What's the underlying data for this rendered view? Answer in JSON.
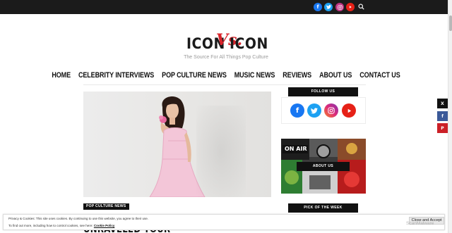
{
  "header": {
    "social_icons": [
      "facebook-icon",
      "twitter-icon",
      "instagram-icon",
      "youtube-icon"
    ],
    "search_icon": "search-icon"
  },
  "logo": {
    "left": "ICON",
    "vs": "Vs.",
    "right": "ICON",
    "tagline": "The Source For All Things Pop Culture"
  },
  "nav": {
    "items": [
      "HOME",
      "CELEBRITY INTERVIEWS",
      "POP CULTURE NEWS",
      "MUSIC NEWS",
      "REVIEWS",
      "ABOUT US",
      "CONTACT US"
    ]
  },
  "featured": {
    "category": "POP CULTURE NEWS",
    "title": "UNRAVELED TOUR"
  },
  "sidebar": {
    "follow_heading": "FOLLOW US",
    "about_heading": "ABOUT US",
    "about_image_text": "ON AIR",
    "pick_heading": "PICK OF THE WEEK"
  },
  "share": {
    "x": "X",
    "facebook": "f",
    "pinterest": "P"
  },
  "cookie": {
    "line1": "Privacy & Cookies: This site uses cookies. By continuing to use this website, you agree to their use.",
    "line2_prefix": "To find out more, including how to control cookies, see here:",
    "policy_link": "Cookie Policy",
    "accept": "Close and Accept"
  },
  "watermark": "ScanMalware",
  "colors": {
    "topbar": "#1b1b1b",
    "accent_red": "#d8232a",
    "facebook": "#1877f2",
    "twitter": "#1da1f2",
    "instagram": "#c13584",
    "youtube": "#e62117"
  }
}
